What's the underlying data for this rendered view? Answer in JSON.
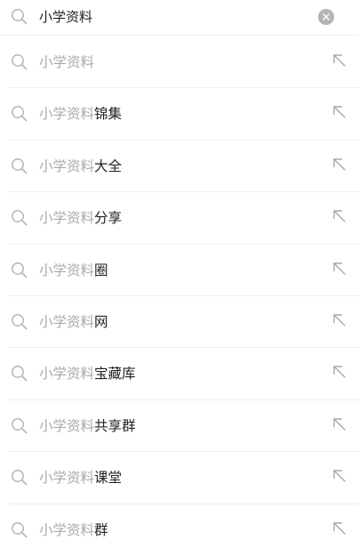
{
  "search": {
    "value": "小学资料",
    "clear_icon": "clear-circle-icon",
    "search_icon": "search-icon"
  },
  "suggestions": [
    {
      "prefix": "小学资料",
      "suffix": ""
    },
    {
      "prefix": "小学资料",
      "suffix": "锦集"
    },
    {
      "prefix": "小学资料",
      "suffix": "大全"
    },
    {
      "prefix": "小学资料",
      "suffix": "分享"
    },
    {
      "prefix": "小学资料",
      "suffix": "圈"
    },
    {
      "prefix": "小学资料",
      "suffix": "网"
    },
    {
      "prefix": "小学资料",
      "suffix": "宝藏库"
    },
    {
      "prefix": "小学资料",
      "suffix": "共享群"
    },
    {
      "prefix": "小学资料",
      "suffix": "课堂"
    },
    {
      "prefix": "小学资料",
      "suffix": "群"
    }
  ],
  "colors": {
    "icon": "#b4b4b4",
    "prefix_text": "#a9a9a9",
    "suffix_text": "#222222",
    "caret": "#2db36a",
    "divider": "#efefef"
  }
}
